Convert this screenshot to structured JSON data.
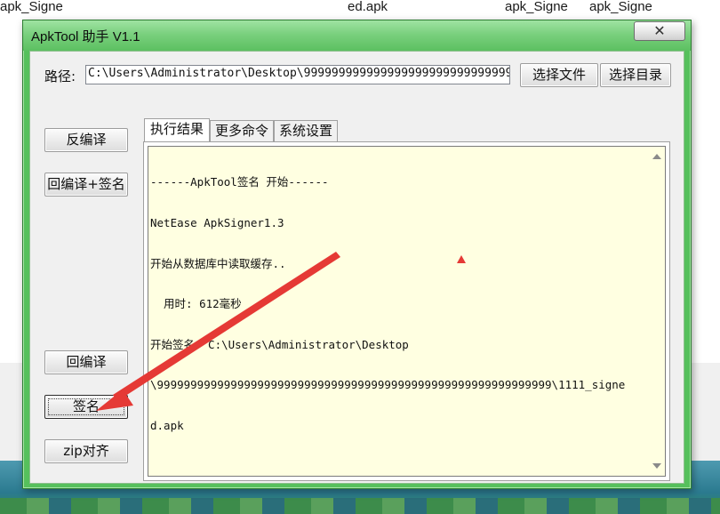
{
  "desktop": {
    "labels": [
      "apk_Signe",
      "ed.apk",
      "apk_Signe",
      "apk_Signe"
    ]
  },
  "window": {
    "title": "ApkTool 助手 V1.1",
    "close_glyph": "✕"
  },
  "path": {
    "label": "路径:",
    "value": "C:\\Users\\Administrator\\Desktop\\9999999999999999999999999999999999"
  },
  "buttons": {
    "select_file": "选择文件",
    "select_dir": "选择目录",
    "decompile": "反编译",
    "recompile_sign": "回编译+签名",
    "recompile": "回编译",
    "sign": "签名",
    "zipalign": "zip对齐"
  },
  "tabs": [
    {
      "label": "执行结果",
      "active": true
    },
    {
      "label": "更多命令",
      "active": false
    },
    {
      "label": "系统设置",
      "active": false
    }
  ],
  "output": {
    "lines": [
      "------ApkTool签名 开始------",
      "NetEase ApkSigner1.3",
      "开始从数据库中读取缓存..",
      "  用时: 612毫秒",
      "开始签名: C:\\Users\\Administrator\\Desktop",
      "\\99999999999999999999999999999999999999999999999999999999999\\1111_signe",
      "d.apk"
    ]
  },
  "colors": {
    "window_frame": "#56c05c",
    "output_bg": "#ffffe1",
    "annotation_arrow": "#e53935"
  },
  "icons": {
    "scroll_up": "scroll-up-arrow-icon",
    "scroll_down": "scroll-down-arrow-icon",
    "annotation": "red-arrow-annotation-icon"
  }
}
